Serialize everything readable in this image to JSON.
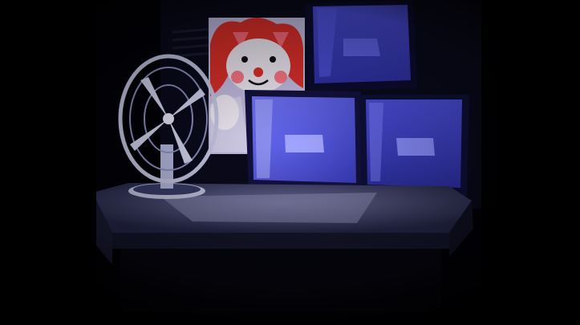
{
  "scene": {
    "type": "office-night-view",
    "objects": [
      "desk",
      "desk-fan",
      "crt-monitor-top",
      "crt-monitor-left",
      "crt-monitor-right",
      "clown-poster"
    ],
    "colors": {
      "background": "#000000",
      "monitor_blue": "#3a3cc8",
      "monitor_highlight": "#8f93ff",
      "desk": "#2a2b4a",
      "poster_red": "#e0302a",
      "fan_metal": "#c9cbe8"
    }
  }
}
